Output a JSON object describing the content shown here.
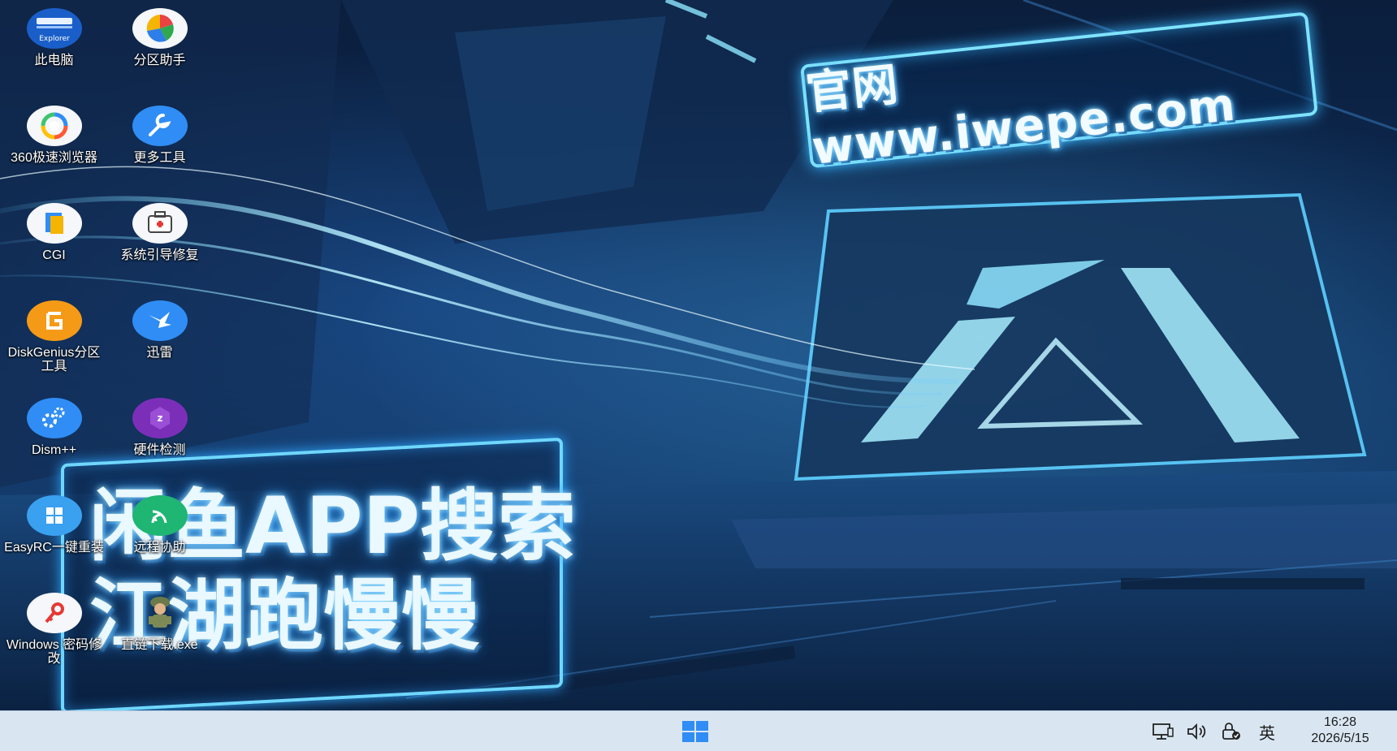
{
  "desktop": {
    "banner_text": "官网www.iwepe.com",
    "slogan_line1": "闲鱼APP搜索",
    "slogan_line2": "江湖跑慢慢"
  },
  "icons": [
    {
      "label": "此电脑",
      "icon": "explorer-icon",
      "badge": "Explorer"
    },
    {
      "label": "分区助手",
      "icon": "partition-assistant-icon"
    },
    {
      "label": "360极速浏览器",
      "icon": "browser-360-icon"
    },
    {
      "label": "更多工具",
      "icon": "wrench-icon"
    },
    {
      "label": "CGI",
      "icon": "cgi-icon"
    },
    {
      "label": "系统引导修复",
      "icon": "toolbox-icon"
    },
    {
      "label": "DiskGenius分区工具",
      "icon": "diskgenius-icon"
    },
    {
      "label": "迅雷",
      "icon": "thunder-bird-icon"
    },
    {
      "label": "Dism++",
      "icon": "gears-icon"
    },
    {
      "label": "硬件检测",
      "icon": "hardware-check-icon"
    },
    {
      "label": "EasyRC一键重装",
      "icon": "windows-logo-icon"
    },
    {
      "label": "远程协助",
      "icon": "remote-assist-icon"
    },
    {
      "label": "Windows 密码修改",
      "icon": "key-icon"
    },
    {
      "label": "直链下载.exe",
      "icon": "soldier-icon"
    }
  ],
  "taskbar": {
    "ime_label": "英",
    "time": "16:28",
    "date": "2026/5/15"
  },
  "colors": {
    "taskbar_bg": "#d9e6f2",
    "start_blue": "#2f8df5",
    "neon": "#7fe3ff"
  }
}
